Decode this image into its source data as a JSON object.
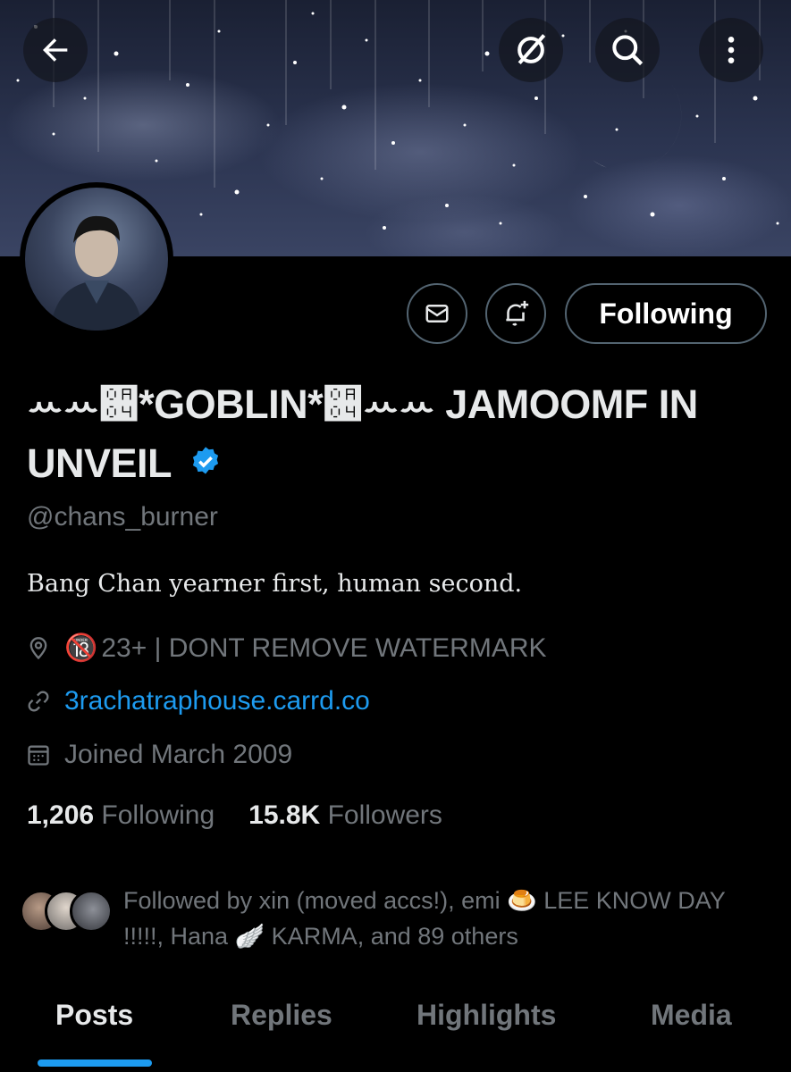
{
  "header": {
    "back_icon": "arrow-left-icon",
    "grok_icon": "slashed-circle-icon",
    "search_icon": "search-icon",
    "more_icon": "more-vertical-icon"
  },
  "profile": {
    "display_name": "ꕀꕀ਄*GOBLIN*਄ꕀꕀ JAMOOMF IN UNVEIL",
    "handle": "@chans_burner",
    "bio": "Bang Chan yearner first, human second.",
    "location_emoji": "🔞",
    "location": "23+ | DONT REMOVE WATERMARK",
    "website": "3rachatraphouse.carrd.co",
    "joined": "Joined March 2009",
    "following_count": "1,206",
    "following_label": "Following",
    "followers_count": "15.8K",
    "followers_label": "Followers",
    "followed_by": "Followed by xin (moved accs!), emi 🍮 LEE KNOW DAY !!!!!, Hana 🪽 KARMA, and 89 others"
  },
  "actions": {
    "message_icon": "envelope-icon",
    "notify_icon": "bell-plus-icon",
    "follow_label": "Following"
  },
  "tabs": [
    {
      "label": "Posts",
      "active": true
    },
    {
      "label": "Replies",
      "active": false
    },
    {
      "label": "Highlights",
      "active": false
    },
    {
      "label": "Media",
      "active": false
    }
  ],
  "colors": {
    "accent": "#1d9bf0",
    "muted": "#71767b",
    "background": "#000000",
    "text": "#e7e9ea"
  }
}
